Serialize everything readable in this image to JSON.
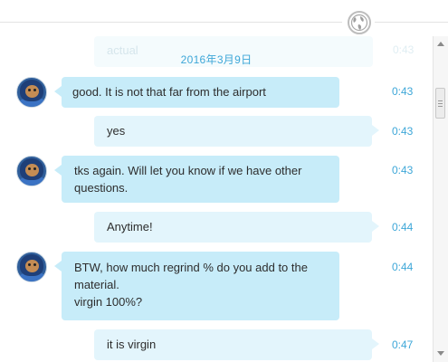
{
  "header": {
    "globe_icon": "globe-icon"
  },
  "ghost": {
    "text": "actual",
    "time": "0:43"
  },
  "date_separator": "2016年3月9日",
  "messages": [
    {
      "dir": "in",
      "lines": [
        "good.  It is not that far from the airport"
      ],
      "time": "0:43"
    },
    {
      "dir": "out",
      "lines": [
        "yes"
      ],
      "time": "0:43"
    },
    {
      "dir": "in",
      "lines": [
        "tks again.  Will let you know if we have other",
        "questions."
      ],
      "time": "0:43"
    },
    {
      "dir": "out",
      "lines": [
        "Anytime!"
      ],
      "time": "0:44"
    },
    {
      "dir": "in",
      "lines": [
        "BTW, how much regrind % do you add to the",
        "material.",
        "virgin 100%?"
      ],
      "time": "0:44"
    },
    {
      "dir": "out",
      "lines": [
        "it is virgin"
      ],
      "time": "0:47"
    }
  ],
  "colors": {
    "incoming_bubble": "#c7ecf9",
    "outgoing_bubble": "#e3f5fc",
    "timestamp": "#3ea7d8"
  }
}
